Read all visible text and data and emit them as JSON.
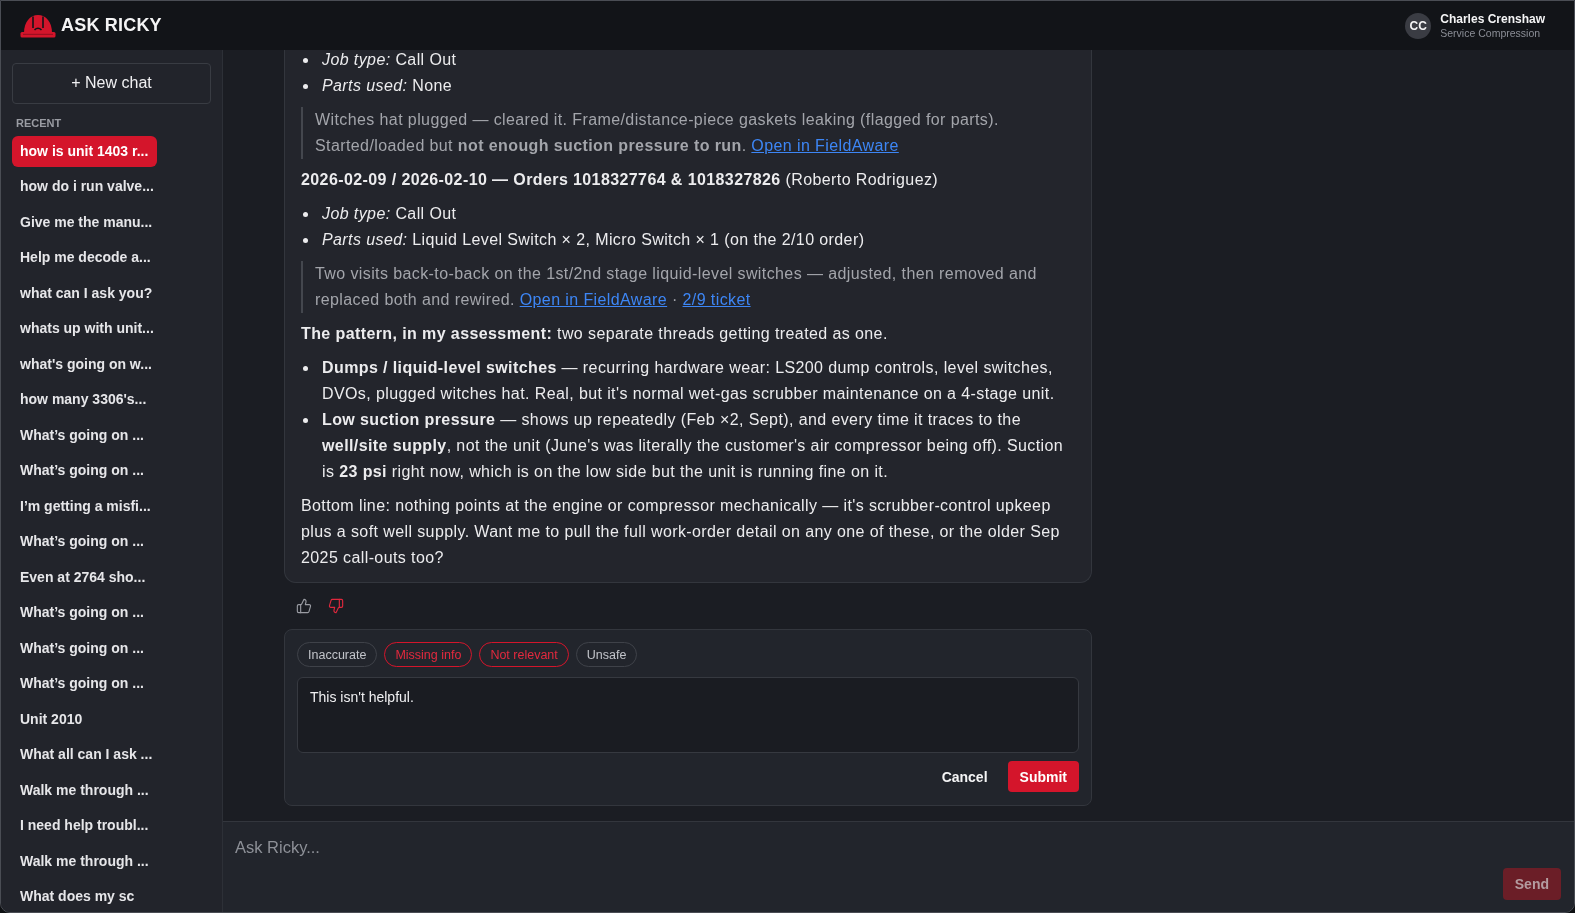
{
  "header": {
    "brand": "ASK RICKY",
    "user": {
      "initials": "CC",
      "name": "Charles Crenshaw",
      "org": "Service Compression"
    }
  },
  "sidebar": {
    "new_chat_button": "+ New chat",
    "section_label": "RECENT",
    "items": [
      {
        "label": "how is unit 1403 r...",
        "selected": true
      },
      {
        "label": "how do i run valve...",
        "selected": false
      },
      {
        "label": "Give me the manu...",
        "selected": false
      },
      {
        "label": "Help me decode a...",
        "selected": false
      },
      {
        "label": "what can I ask you?",
        "selected": false
      },
      {
        "label": "whats up with unit...",
        "selected": false
      },
      {
        "label": "what's going on w...",
        "selected": false
      },
      {
        "label": "how many 3306's...",
        "selected": false
      },
      {
        "label": "What’s going on ...",
        "selected": false
      },
      {
        "label": "What’s going on ...",
        "selected": false
      },
      {
        "label": "I’m getting a misfi...",
        "selected": false
      },
      {
        "label": "What’s going on ...",
        "selected": false
      },
      {
        "label": "Even at 2764 sho...",
        "selected": false
      },
      {
        "label": "What’s going on ...",
        "selected": false
      },
      {
        "label": "What’s going on ...",
        "selected": false
      },
      {
        "label": "What’s going on ...",
        "selected": false
      },
      {
        "label": "Unit 2010",
        "selected": false
      },
      {
        "label": "What all can I ask ...",
        "selected": false
      },
      {
        "label": "Walk me through ...",
        "selected": false
      },
      {
        "label": "I need help troubl...",
        "selected": false
      },
      {
        "label": "Walk me through ...",
        "selected": false
      },
      {
        "label": "What does my sc",
        "selected": false
      }
    ]
  },
  "message": {
    "blocks": [
      {
        "kind": "list",
        "items": [
          "*Job type:* Call Out",
          "*Parts used:* None"
        ]
      },
      {
        "kind": "quote",
        "parts": [
          {
            "kind": "text",
            "text": "Witches hat plugged — cleared it. Frame/distance-piece gaskets leaking (flagged for parts). Started/loaded but **not enough suction pressure to run**. "
          },
          {
            "kind": "link",
            "text": "Open in FieldAware"
          }
        ]
      },
      {
        "kind": "paragraph",
        "text": "**2026-02-09 / 2026-02-10 — Orders 1018327764 & 1018327826** (Roberto Rodriguez)"
      },
      {
        "kind": "list",
        "items": [
          "*Job type:* Call Out",
          "*Parts used:* Liquid Level Switch × 2, Micro Switch × 1 (on the 2/10 order)"
        ]
      },
      {
        "kind": "quote",
        "parts": [
          {
            "kind": "text",
            "text": "Two visits back-to-back on the 1st/2nd stage liquid-level switches — adjusted, then removed and replaced both and rewired. "
          },
          {
            "kind": "link",
            "text": "Open in FieldAware"
          },
          {
            "kind": "text",
            "text": " · "
          },
          {
            "kind": "link",
            "text": "2/9 ticket"
          }
        ]
      },
      {
        "kind": "paragraph",
        "text": "**The pattern, in my assessment:** two separate threads getting treated as one."
      },
      {
        "kind": "list",
        "items": [
          "**Dumps / liquid-level switches** — recurring hardware wear: LS200 dump controls, level switches, DVOs, plugged witches hat. Real, but it's normal wet-gas scrubber maintenance on a 4-stage unit.",
          "**Low suction pressure** — shows up repeatedly (Feb ×2, Sept), and every time it traces to the **well/site supply**, not the unit (June's was literally the customer's air compressor being off). Suction is **23 psi** right now, which is on the low side but the unit is running fine on it."
        ]
      },
      {
        "kind": "paragraph",
        "text": "Bottom line: nothing points at the engine or compressor mechanically — it's scrubber-control upkeep plus a soft well supply. Want me to pull the full work-order detail on any one of these, or the older Sep 2025 call-outs too?"
      }
    ]
  },
  "rating": [
    {
      "kind": "up",
      "selected": false
    },
    {
      "kind": "down",
      "selected": true
    }
  ],
  "feedback": {
    "tags": [
      {
        "label": "Inaccurate",
        "selected": false
      },
      {
        "label": "Missing info",
        "selected": true
      },
      {
        "label": "Not relevant",
        "selected": true
      },
      {
        "label": "Unsafe",
        "selected": false
      }
    ],
    "comment": "This isn't helpful.",
    "cancel_button": "Cancel",
    "submit_button": "Submit"
  },
  "composer": {
    "placeholder": "Ask Ricky...",
    "send_button": {
      "label": "Send",
      "disabled": true
    }
  }
}
